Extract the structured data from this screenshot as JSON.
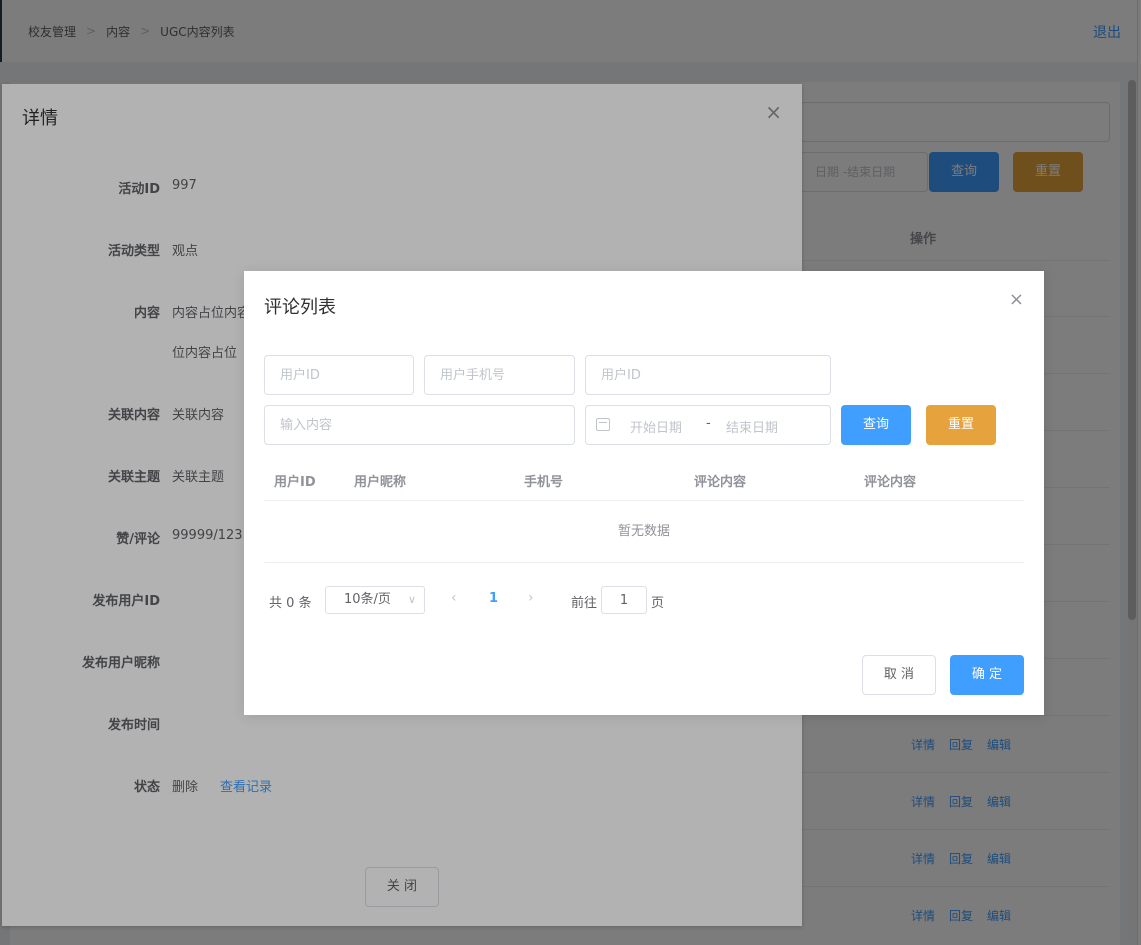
{
  "breadcrumb": [
    "校友管理",
    "内容",
    "UGC内容列表"
  ],
  "breadcrumb_sep": ">",
  "header": {
    "logout": "退出"
  },
  "background": {
    "date_placeholder": "日期 -结束日期",
    "query_label": "查询",
    "reset_label": "重置",
    "op_header": "操作",
    "row_actions": [
      "详情",
      "回复",
      "编辑"
    ]
  },
  "detail": {
    "title": "详情",
    "close_icon": "×",
    "fields": [
      {
        "label": "活动ID",
        "value": "997"
      },
      {
        "label": "活动类型",
        "value": "观点"
      },
      {
        "label": "内容",
        "value": "内容占位内容",
        "value2": "位内容占位"
      },
      {
        "label": "关联内容",
        "value": "关联内容"
      },
      {
        "label": "关联主题",
        "value": "关联主题"
      },
      {
        "label": "赞/评论",
        "value": "99999/123"
      },
      {
        "label": "发布用户ID",
        "value": ""
      },
      {
        "label": "发布用户昵称",
        "value": ""
      },
      {
        "label": "发布时间",
        "value": ""
      },
      {
        "label": "状态",
        "value": "删除",
        "link": "查看记录"
      }
    ],
    "close_button": "关 闭"
  },
  "comment_dialog": {
    "title": "评论列表",
    "close_icon": "×",
    "filters": {
      "user_id_placeholder": "用户ID",
      "phone_placeholder": "用户手机号",
      "user_id2_placeholder": "用户ID",
      "content_placeholder": "输入内容",
      "start_date_placeholder": "开始日期",
      "date_separator": "-",
      "end_date_placeholder": "结束日期"
    },
    "query_label": "查询",
    "reset_label": "重置",
    "columns": [
      "用户ID",
      "用户昵称",
      "手机号",
      "评论内容",
      "评论内容"
    ],
    "empty_text": "暂无数据",
    "pager": {
      "total": "共 0 条",
      "page_size": "10条/页",
      "current_page": "1",
      "goto_label": "前往",
      "goto_value": "1",
      "page_suffix": "页"
    },
    "cancel_label": "取 消",
    "ok_label": "确 定"
  }
}
